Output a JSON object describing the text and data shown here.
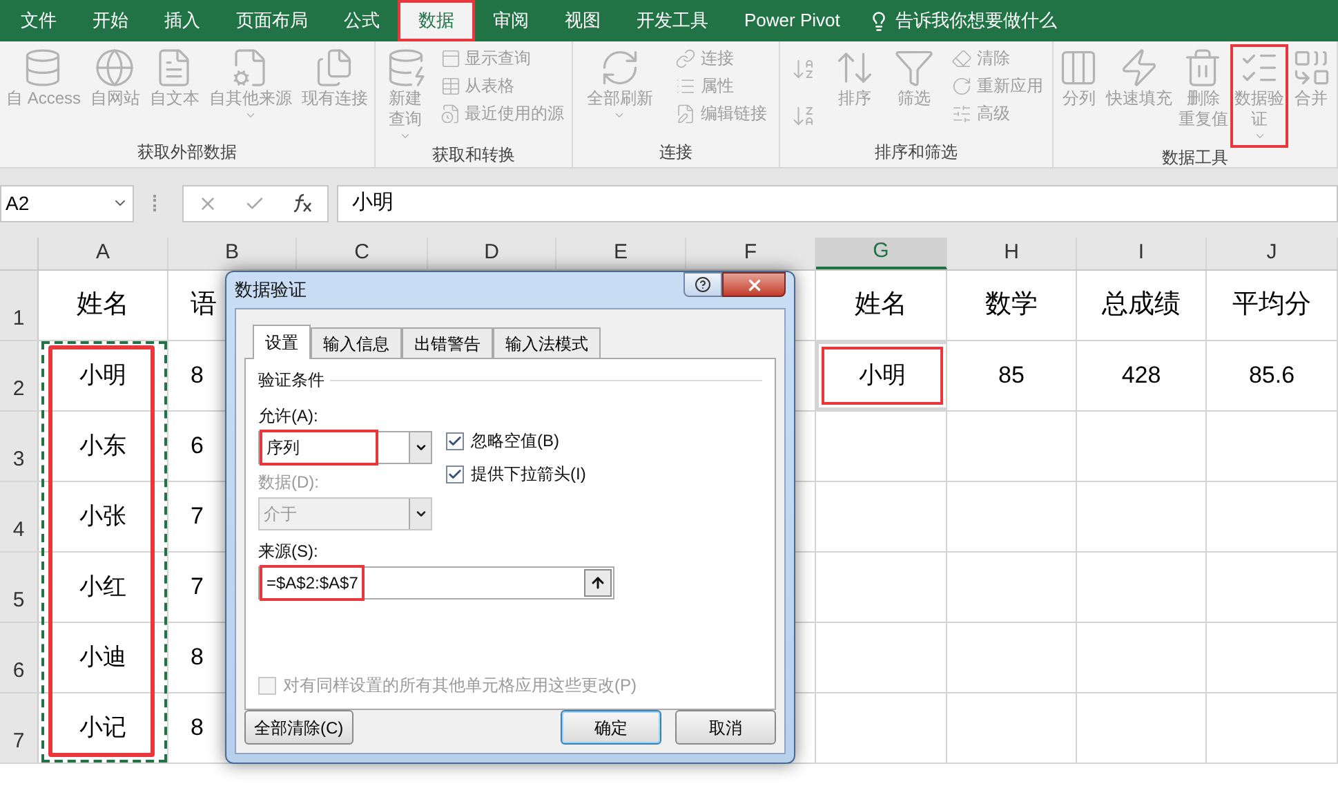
{
  "menu_tabs": [
    {
      "label": "文件",
      "selected": false,
      "highlighted": false
    },
    {
      "label": "开始",
      "selected": false,
      "highlighted": false
    },
    {
      "label": "插入",
      "selected": false,
      "highlighted": false
    },
    {
      "label": "页面布局",
      "selected": false,
      "highlighted": false
    },
    {
      "label": "公式",
      "selected": false,
      "highlighted": false
    },
    {
      "label": "数据",
      "selected": true,
      "highlighted": true
    },
    {
      "label": "审阅",
      "selected": false,
      "highlighted": false
    },
    {
      "label": "视图",
      "selected": false,
      "highlighted": false
    },
    {
      "label": "开发工具",
      "selected": false,
      "highlighted": false
    },
    {
      "label": "Power Pivot",
      "selected": false,
      "highlighted": false
    }
  ],
  "tell_me": "告诉我你想要做什么",
  "ribbon": {
    "disabled": true,
    "groups": [
      {
        "label": "获取外部数据",
        "columns": [
          [
            {
              "kind": "large",
              "lines": [
                "自 Access"
              ],
              "dropdown": false,
              "highlighted": false
            }
          ],
          [
            {
              "kind": "large",
              "lines": [
                "自网站"
              ],
              "dropdown": false,
              "highlighted": false
            }
          ],
          [
            {
              "kind": "large",
              "lines": [
                "自文本"
              ],
              "dropdown": false,
              "highlighted": false
            }
          ],
          [
            {
              "kind": "large",
              "lines": [
                "自其他来源"
              ],
              "dropdown": true,
              "highlighted": false
            }
          ],
          [
            {
              "kind": "large",
              "lines": [
                "现有连接"
              ],
              "dropdown": false,
              "highlighted": false
            }
          ]
        ]
      },
      {
        "label": "获取和转换",
        "columns": [
          [
            {
              "kind": "large",
              "lines": [
                "新建",
                "查询"
              ],
              "dropdown": true,
              "highlighted": false
            }
          ],
          [
            {
              "kind": "small",
              "lines": [
                "显示查询"
              ]
            },
            {
              "kind": "small",
              "lines": [
                "从表格"
              ]
            },
            {
              "kind": "small",
              "lines": [
                "最近使用的源"
              ]
            }
          ]
        ]
      },
      {
        "label": "连接",
        "columns": [
          [
            {
              "kind": "large",
              "lines": [
                "全部刷新"
              ],
              "dropdown": true,
              "highlighted": false
            }
          ],
          [
            {
              "kind": "small",
              "lines": [
                "连接"
              ]
            },
            {
              "kind": "small",
              "lines": [
                "属性"
              ]
            },
            {
              "kind": "small",
              "lines": [
                "编辑链接"
              ]
            }
          ]
        ]
      },
      {
        "label": "排序和筛选",
        "columns": [
          [
            {
              "kind": "icon"
            },
            {
              "kind": "icon"
            }
          ],
          [
            {
              "kind": "large",
              "lines": [
                "排序"
              ],
              "dropdown": false,
              "highlighted": false
            }
          ],
          [
            {
              "kind": "large",
              "lines": [
                "筛选"
              ],
              "dropdown": false,
              "highlighted": false
            }
          ],
          [
            {
              "kind": "small",
              "lines": [
                "清除"
              ]
            },
            {
              "kind": "small",
              "lines": [
                "重新应用"
              ]
            },
            {
              "kind": "small",
              "lines": [
                "高级"
              ]
            }
          ]
        ]
      },
      {
        "label": "数据工具",
        "columns": [
          [
            {
              "kind": "large",
              "lines": [
                "分列"
              ],
              "dropdown": false,
              "highlighted": false
            }
          ],
          [
            {
              "kind": "large",
              "lines": [
                "快速填充"
              ],
              "dropdown": false,
              "highlighted": false
            }
          ],
          [
            {
              "kind": "large",
              "lines": [
                "删除",
                "重复值"
              ],
              "dropdown": false,
              "highlighted": false
            }
          ],
          [
            {
              "kind": "large",
              "lines": [
                "数据验",
                "证"
              ],
              "dropdown": true,
              "highlighted": true
            }
          ],
          [
            {
              "kind": "large",
              "lines": [
                "合并"
              ],
              "dropdown": false,
              "highlighted": false
            }
          ]
        ]
      }
    ]
  },
  "formula_bar": {
    "name_box": "A2",
    "value": "小明"
  },
  "sheet": {
    "columns": [
      {
        "label": "A",
        "selected": false
      },
      {
        "label": "B",
        "selected": false
      },
      {
        "label": "C",
        "selected": false
      },
      {
        "label": "D",
        "selected": false
      },
      {
        "label": "E",
        "selected": false
      },
      {
        "label": "F",
        "selected": false
      },
      {
        "label": "G",
        "selected": true
      },
      {
        "label": "H",
        "selected": false
      },
      {
        "label": "I",
        "selected": false
      },
      {
        "label": "J",
        "selected": false
      }
    ],
    "rows": [
      {
        "number": "1",
        "cells": [
          "姓名",
          "语",
          null,
          null,
          null,
          null,
          "姓名",
          "数学",
          "总成绩",
          "平均分"
        ]
      },
      {
        "number": "2",
        "cells": [
          "小明",
          "8",
          null,
          null,
          null,
          null,
          "小明",
          "85",
          "428",
          "85.6"
        ]
      },
      {
        "number": "3",
        "cells": [
          "小东",
          "6",
          null,
          null,
          null,
          null,
          null,
          null,
          null,
          null
        ]
      },
      {
        "number": "4",
        "cells": [
          "小张",
          "7",
          null,
          null,
          null,
          null,
          null,
          null,
          null,
          null
        ]
      },
      {
        "number": "5",
        "cells": [
          "小红",
          "7",
          null,
          null,
          null,
          null,
          null,
          null,
          null,
          null
        ]
      },
      {
        "number": "6",
        "cells": [
          "小迪",
          "8",
          null,
          null,
          null,
          null,
          null,
          null,
          null,
          null
        ]
      },
      {
        "number": "7",
        "cells": [
          "小记",
          "8",
          null,
          null,
          null,
          null,
          null,
          null,
          null,
          null
        ]
      }
    ]
  },
  "dialog": {
    "title": "数据验证",
    "tabs": [
      {
        "label": "设置",
        "selected": true
      },
      {
        "label": "输入信息",
        "selected": false
      },
      {
        "label": "出错警告",
        "selected": false
      },
      {
        "label": "输入法模式",
        "selected": false
      }
    ],
    "section": "验证条件",
    "allow": {
      "label": "允许(A):",
      "value": "序列",
      "highlighted": true
    },
    "ignore_blank": {
      "label": "忽略空值(B)",
      "checked": true
    },
    "in_cell_dropdown": {
      "label": "提供下拉箭头(I)",
      "checked": true
    },
    "data": {
      "label": "数据(D):",
      "value": "介于",
      "disabled": true
    },
    "source": {
      "label": "来源(S):",
      "value": "=$A$2:$A$7",
      "highlighted": true
    },
    "apply_all": {
      "label": "对有同样设置的所有其他单元格应用这些更改(P)",
      "checked": false,
      "disabled": true
    },
    "buttons": [
      {
        "label": "全部清除(C)",
        "default": false
      },
      {
        "label": "确定",
        "default": true
      },
      {
        "label": "取消",
        "default": false
      }
    ]
  }
}
